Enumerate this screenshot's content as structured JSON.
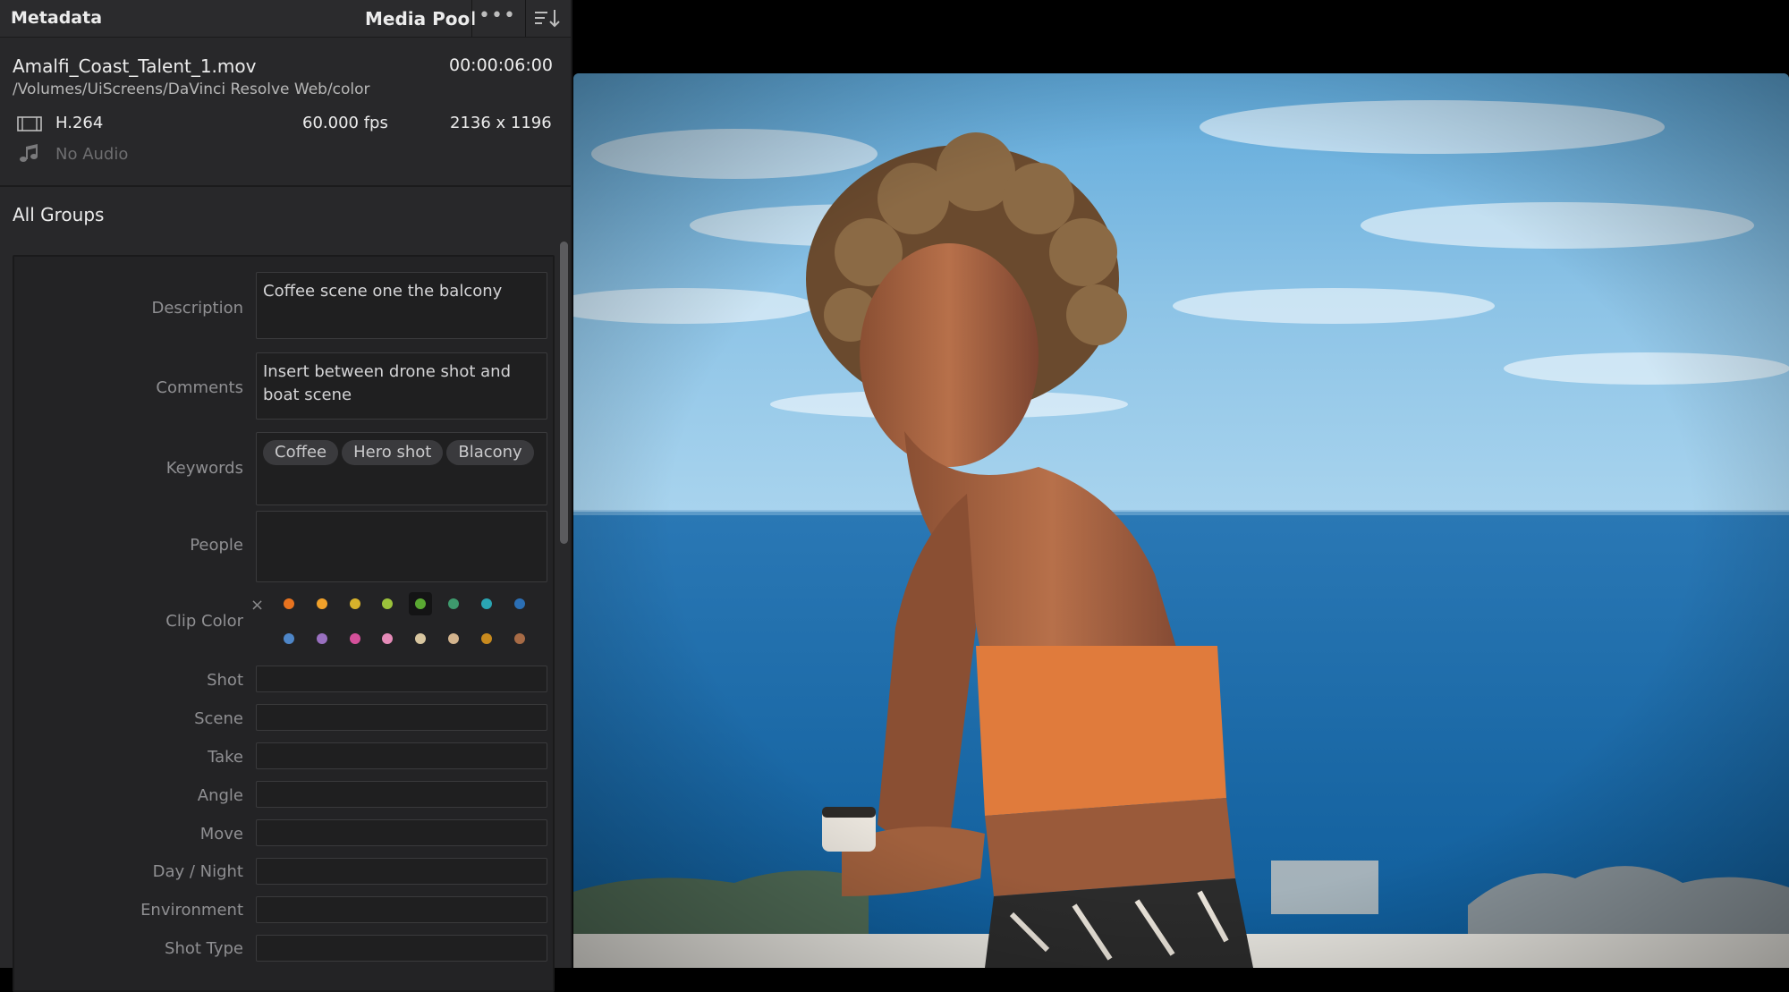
{
  "header": {
    "title": "Metadata",
    "pool_label": "Media Pool",
    "more_label": "•••"
  },
  "clip": {
    "name": "Amalfi_Coast_Talent_1.mov",
    "timecode": "00:00:06:00",
    "path": "/Volumes/UiScreens/DaVinci Resolve Web/color",
    "codec": "H.264",
    "fps": "60.000 fps",
    "resolution": "2136 x 1196",
    "audio": "No Audio"
  },
  "groups_label": "All Groups",
  "form": {
    "description_label": "Description",
    "description_value": "Coffee scene one the balcony",
    "comments_label": "Comments",
    "comments_value": "Insert between drone shot and boat scene",
    "keywords_label": "Keywords",
    "keywords": [
      "Coffee",
      "Hero shot",
      "Blacony"
    ],
    "people_label": "People",
    "people_value": "",
    "clip_color_label": "Clip Color",
    "clear_symbol": "×",
    "fields": [
      {
        "label": "Shot",
        "value": ""
      },
      {
        "label": "Scene",
        "value": ""
      },
      {
        "label": "Take",
        "value": ""
      },
      {
        "label": "Angle",
        "value": ""
      },
      {
        "label": "Move",
        "value": ""
      },
      {
        "label": "Day / Night",
        "value": ""
      },
      {
        "label": "Environment",
        "value": ""
      },
      {
        "label": "Shot Type",
        "value": ""
      }
    ]
  },
  "colors": {
    "row1": [
      "#e8731f",
      "#f1a12a",
      "#d8b22b",
      "#9bc23b",
      "#5aa832",
      "#3e9a6d",
      "#2aa5b3",
      "#2b6fb5"
    ],
    "row2": [
      "#4e86c8",
      "#9970c0",
      "#d4509a",
      "#e58bb8",
      "#d8c6a0",
      "#d3b48e",
      "#c88a1e",
      "#a76b46"
    ],
    "selected_index": 4
  }
}
